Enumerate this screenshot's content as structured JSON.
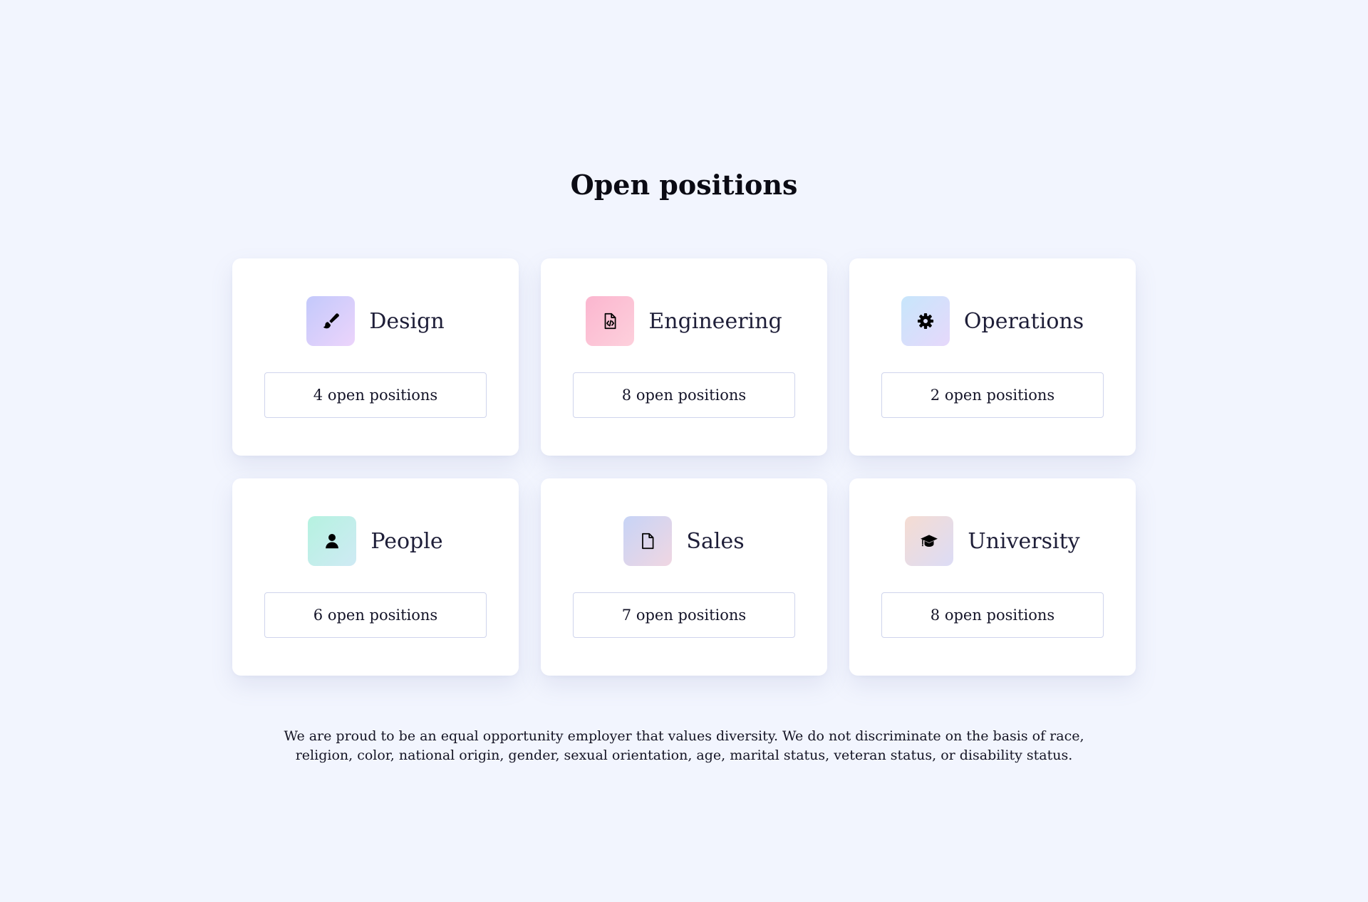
{
  "heading": "Open positions",
  "departments": [
    {
      "name": "Design",
      "positions_label": "4 open positions",
      "icon": "paintbrush-icon",
      "gradient": [
        "#c3c9fb",
        "#ecd4fb"
      ]
    },
    {
      "name": "Engineering",
      "positions_label": "8 open positions",
      "icon": "code-file-icon",
      "gradient": [
        "#fbb6cf",
        "#fdd0dc"
      ]
    },
    {
      "name": "Operations",
      "positions_label": "2 open positions",
      "icon": "gear-icon",
      "gradient": [
        "#c7e6fb",
        "#e6d8fb"
      ]
    },
    {
      "name": "People",
      "positions_label": "6 open positions",
      "icon": "user-icon",
      "gradient": [
        "#b5f2e0",
        "#cfeaf4"
      ]
    },
    {
      "name": "Sales",
      "positions_label": "7 open positions",
      "icon": "document-icon",
      "gradient": [
        "#c7d4f6",
        "#f0d6e2"
      ]
    },
    {
      "name": "University",
      "positions_label": "8 open positions",
      "icon": "graduation-cap-icon",
      "gradient": [
        "#f5dcd2",
        "#dcdcf6"
      ]
    }
  ],
  "footer": {
    "line1": "We are proud to be an equal opportunity employer that values diversity. We do not discriminate on the basis of race,",
    "line2": "religion, color, national origin, gender, sexual orientation, age, marital status, veteran status, or disability status."
  }
}
